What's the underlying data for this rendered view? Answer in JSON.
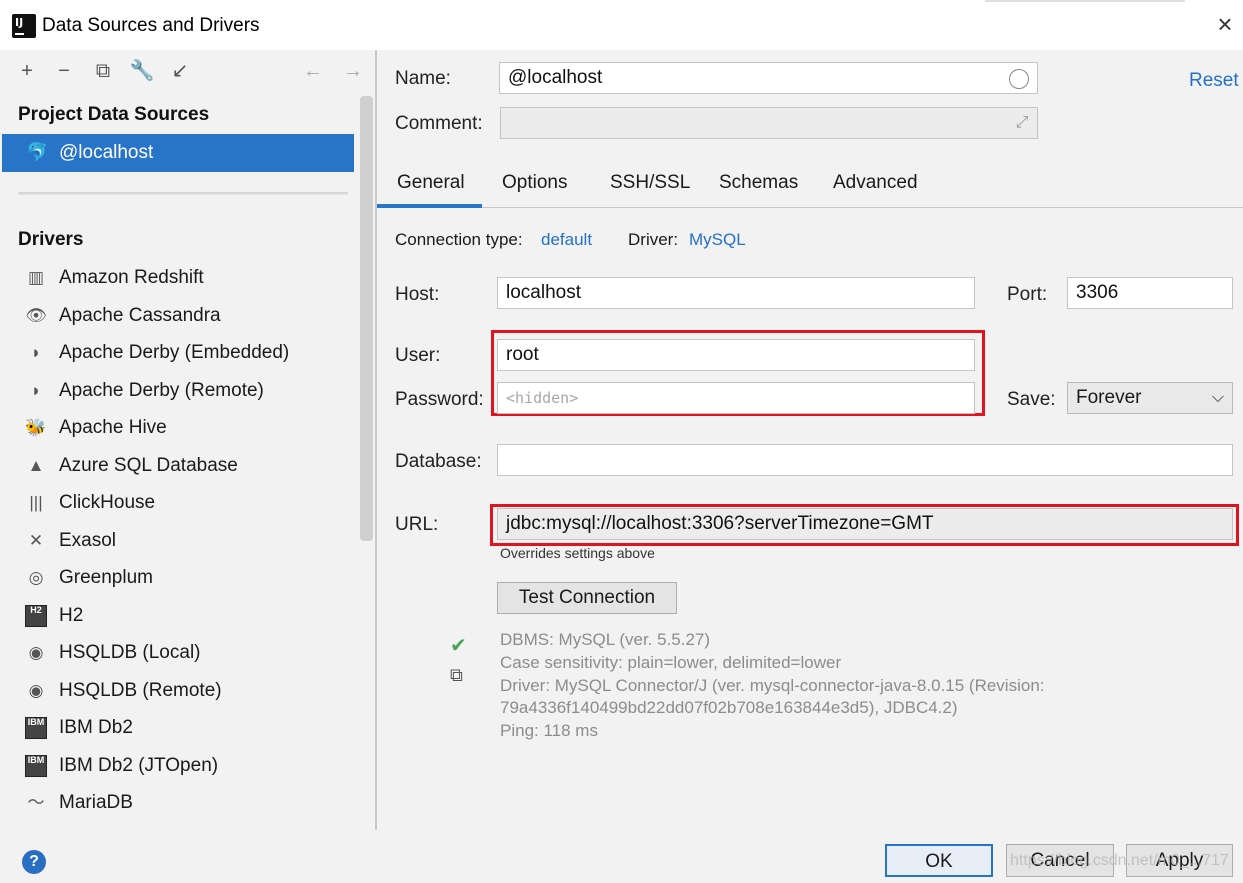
{
  "window": {
    "title": "Data Sources and Drivers",
    "logo_text": "IJ"
  },
  "toolbar": {
    "add": "+",
    "remove": "−",
    "copy": "⧉",
    "settings": "🔧",
    "import": "↙",
    "back": "←",
    "forward": "→"
  },
  "left": {
    "project_title": "Project Data Sources",
    "selected_source": "@localhost",
    "drivers_title": "Drivers",
    "drivers": [
      {
        "label": "Amazon Redshift",
        "icon": "▥"
      },
      {
        "label": "Apache Cassandra",
        "icon": "👁"
      },
      {
        "label": "Apache Derby (Embedded)",
        "icon": "◗"
      },
      {
        "label": "Apache Derby (Remote)",
        "icon": "◗"
      },
      {
        "label": "Apache Hive",
        "icon": "🐝"
      },
      {
        "label": "Azure SQL Database",
        "icon": "▲"
      },
      {
        "label": "ClickHouse",
        "icon": "|||"
      },
      {
        "label": "Exasol",
        "icon": "✕"
      },
      {
        "label": "Greenplum",
        "icon": "◎"
      },
      {
        "label": "H2",
        "icon": "H2"
      },
      {
        "label": "HSQLDB (Local)",
        "icon": "◉"
      },
      {
        "label": "HSQLDB (Remote)",
        "icon": "◉"
      },
      {
        "label": "IBM Db2",
        "icon": "IBM"
      },
      {
        "label": "IBM Db2 (JTOpen)",
        "icon": "IBM"
      },
      {
        "label": "MariaDB",
        "icon": "〜"
      }
    ]
  },
  "form": {
    "name_label": "Name:",
    "name_value": "@localhost",
    "comment_label": "Comment:",
    "comment_value": "",
    "reset": "Reset"
  },
  "tabs": [
    "General",
    "Options",
    "SSH/SSL",
    "Schemas",
    "Advanced"
  ],
  "general": {
    "connection_type_label": "Connection type:",
    "connection_type_value": "default",
    "driver_label": "Driver:",
    "driver_value": "MySQL",
    "host_label": "Host:",
    "host_value": "localhost",
    "port_label": "Port:",
    "port_value": "3306",
    "user_label": "User:",
    "user_value": "root",
    "password_label": "Password:",
    "password_placeholder": "<hidden>",
    "save_label": "Save:",
    "save_value": "Forever",
    "database_label": "Database:",
    "database_value": "",
    "url_label": "URL:",
    "url_value": "jdbc:mysql://localhost:3306?serverTimezone=GMT",
    "url_hint": "Overrides settings above",
    "test_button": "Test Connection",
    "info": [
      "DBMS: MySQL (ver. 5.5.27)",
      "Case sensitivity: plain=lower, delimited=lower",
      "Driver: MySQL Connector/J (ver. mysql-connector-java-8.0.15 (Revision:",
      "79a4336f140499bd22dd07f02b708e163844e3d5), JDBC4.2)",
      "Ping: 118 ms"
    ]
  },
  "buttons": {
    "help": "?",
    "ok": "OK",
    "cancel": "Cancel",
    "apply": "Apply"
  },
  "watermark": "https://blog.csdn.net/m0_...717",
  "colors": {
    "accent": "#2874c9",
    "link": "#2470c8",
    "highlight_box": "#e0141e",
    "success": "#4aa35a"
  }
}
